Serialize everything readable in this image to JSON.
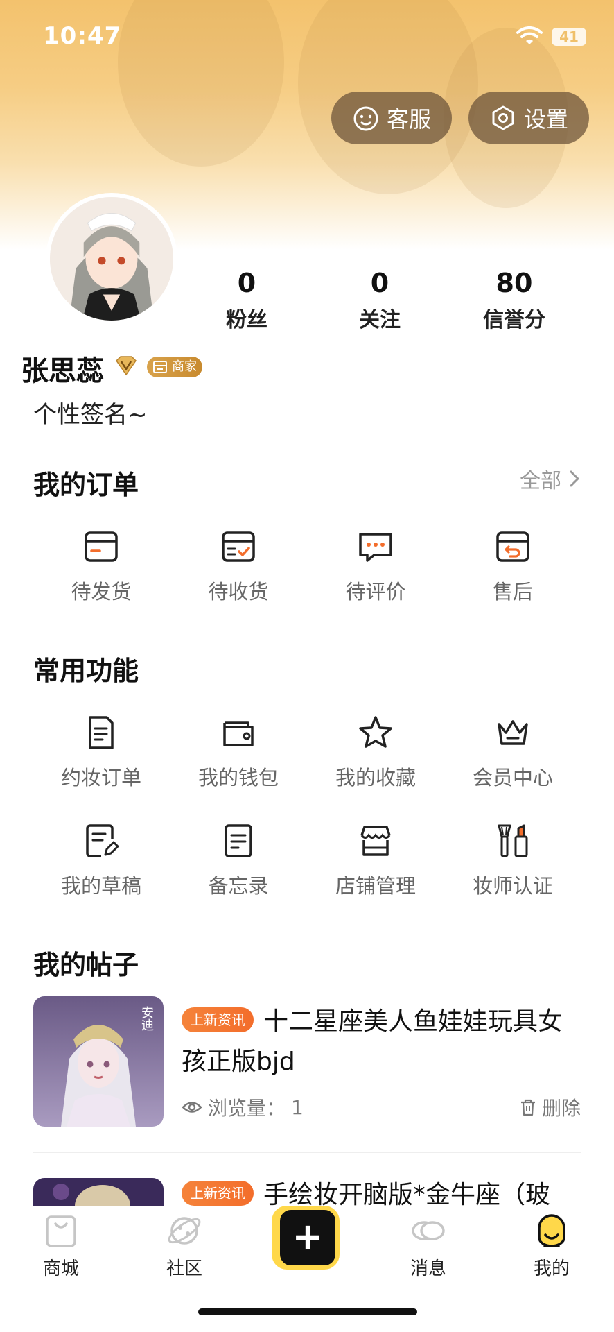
{
  "status_bar": {
    "time": "10:47",
    "battery": "41"
  },
  "header": {
    "service_label": "客服",
    "settings_label": "设置"
  },
  "profile": {
    "username": "张思蕊",
    "merchant_badge": "商家",
    "signature": "个性签名~",
    "stats": [
      {
        "value": "0",
        "label": "粉丝"
      },
      {
        "value": "0",
        "label": "关注"
      },
      {
        "value": "80",
        "label": "信誉分"
      }
    ]
  },
  "orders": {
    "title": "我的订单",
    "see_all": "全部",
    "items": [
      {
        "label": "待发货",
        "icon": "box-pending-ship-icon"
      },
      {
        "label": "待收货",
        "icon": "box-check-icon"
      },
      {
        "label": "待评价",
        "icon": "chat-bubble-icon"
      },
      {
        "label": "售后",
        "icon": "box-return-icon"
      }
    ]
  },
  "functions": {
    "title": "常用功能",
    "items": [
      {
        "label": "约妆订单",
        "icon": "document-list-icon"
      },
      {
        "label": "我的钱包",
        "icon": "wallet-icon"
      },
      {
        "label": "我的收藏",
        "icon": "star-icon"
      },
      {
        "label": "会员中心",
        "icon": "crown-icon"
      },
      {
        "label": "我的草稿",
        "icon": "draft-edit-icon"
      },
      {
        "label": "备忘录",
        "icon": "memo-icon"
      },
      {
        "label": "店铺管理",
        "icon": "store-icon"
      },
      {
        "label": "妆师认证",
        "icon": "makeup-tools-icon"
      }
    ]
  },
  "posts": {
    "title": "我的帖子",
    "items": [
      {
        "tag": "上新资讯",
        "title": "十二星座美人鱼娃娃玩具女孩正版bjd",
        "views_label": "浏览量：",
        "views": "1",
        "delete_label": "删除",
        "thumb_text": "安迪"
      },
      {
        "tag": "上新资讯",
        "title": "手绘妆开脑版*金牛座（玻"
      }
    ]
  },
  "tabbar": {
    "items": [
      {
        "label": "商城",
        "icon": "shopping-bag-icon"
      },
      {
        "label": "社区",
        "icon": "planet-icon"
      },
      {
        "label": "",
        "icon": "plus-icon"
      },
      {
        "label": "消息",
        "icon": "message-bubbles-icon"
      },
      {
        "label": "我的",
        "icon": "profile-face-icon"
      }
    ]
  },
  "colors": {
    "hero_gradient_top": "#f3c26d",
    "accent_orange": "#f36d2b",
    "merchant_gold": "#d8a24b",
    "tab_active_yellow": "#ffd84a"
  }
}
